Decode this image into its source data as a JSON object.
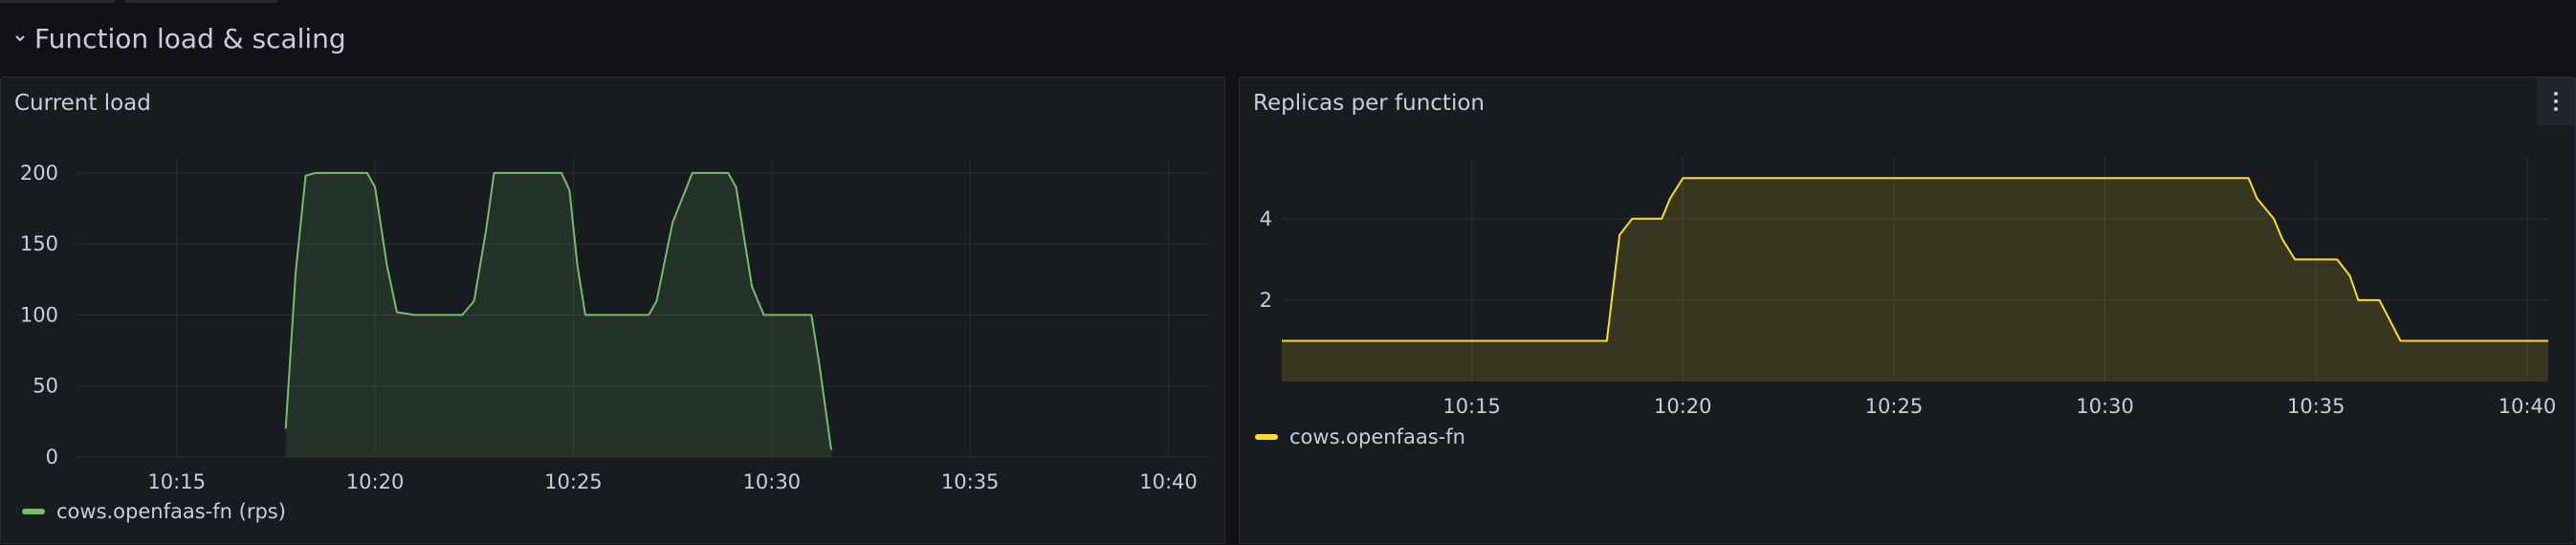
{
  "row": {
    "title": "Function load & scaling"
  },
  "chart_data": [
    {
      "type": "area",
      "title": "Current load",
      "xlabel": "",
      "ylabel": "",
      "x_type": "time",
      "xlim": [
        "10:12.5",
        "10:41"
      ],
      "ylim": [
        0,
        210
      ],
      "x_ticks": [
        "10:15",
        "10:20",
        "10:25",
        "10:30",
        "10:35",
        "10:40"
      ],
      "y_ticks": [
        0,
        50,
        100,
        150,
        200
      ],
      "grid": true,
      "legend_position": "bottom-left",
      "color": "#73bf69",
      "series": [
        {
          "name": "cows.openfaas-fn (rps)",
          "x": [
            "10:17.75",
            "10:18",
            "10:18.25",
            "10:18.5",
            "10:19",
            "10:19.5",
            "10:19.8",
            "10:20",
            "10:20.3",
            "10:20.55",
            "10:21",
            "10:22",
            "10:22.2",
            "10:22.5",
            "10:22.8",
            "10:23",
            "10:24",
            "10:24.7",
            "10:24.9",
            "10:25.1",
            "10:25.3",
            "10:26",
            "10:26.5",
            "10:26.9",
            "10:27.1",
            "10:27.5",
            "10:28",
            "10:28.9",
            "10:29.1",
            "10:29.5",
            "10:29.8",
            "10:30",
            "10:31",
            "10:31.2",
            "10:31.5"
          ],
          "values": [
            20,
            130,
            198,
            200,
            200,
            200,
            200,
            190,
            135,
            102,
            100,
            100,
            100,
            110,
            160,
            200,
            200,
            200,
            188,
            135,
            100,
            100,
            100,
            100,
            110,
            165,
            200,
            200,
            190,
            120,
            100,
            100,
            100,
            65,
            5
          ]
        }
      ]
    },
    {
      "type": "area",
      "title": "Replicas per function",
      "xlabel": "",
      "ylabel": "",
      "x_type": "time",
      "xlim": [
        "10:10.5",
        "10:40.5"
      ],
      "ylim": [
        0,
        5.5
      ],
      "x_ticks": [
        "10:15",
        "10:20",
        "10:25",
        "10:30",
        "10:35",
        "10:40"
      ],
      "y_ticks": [
        2,
        4
      ],
      "grid": true,
      "legend_position": "bottom-left",
      "color": "#fade2a",
      "series": [
        {
          "name": "cows.openfaas-fn",
          "x": [
            "10:10.5",
            "10:18.2",
            "10:18.5",
            "10:18.8",
            "10:19",
            "10:19.5",
            "10:19.7",
            "10:20",
            "10:33",
            "10:33.4",
            "10:33.6",
            "10:34",
            "10:34.2",
            "10:34.5",
            "10:35.5",
            "10:35.8",
            "10:36",
            "10:36.5",
            "10:36.7",
            "10:37",
            "10:40.5"
          ],
          "values": [
            1,
            1,
            3.6,
            4,
            4,
            4,
            4.5,
            5,
            5,
            5,
            4.5,
            4,
            3.5,
            3,
            3,
            2.6,
            2,
            2,
            1.6,
            1,
            1
          ]
        }
      ]
    }
  ]
}
